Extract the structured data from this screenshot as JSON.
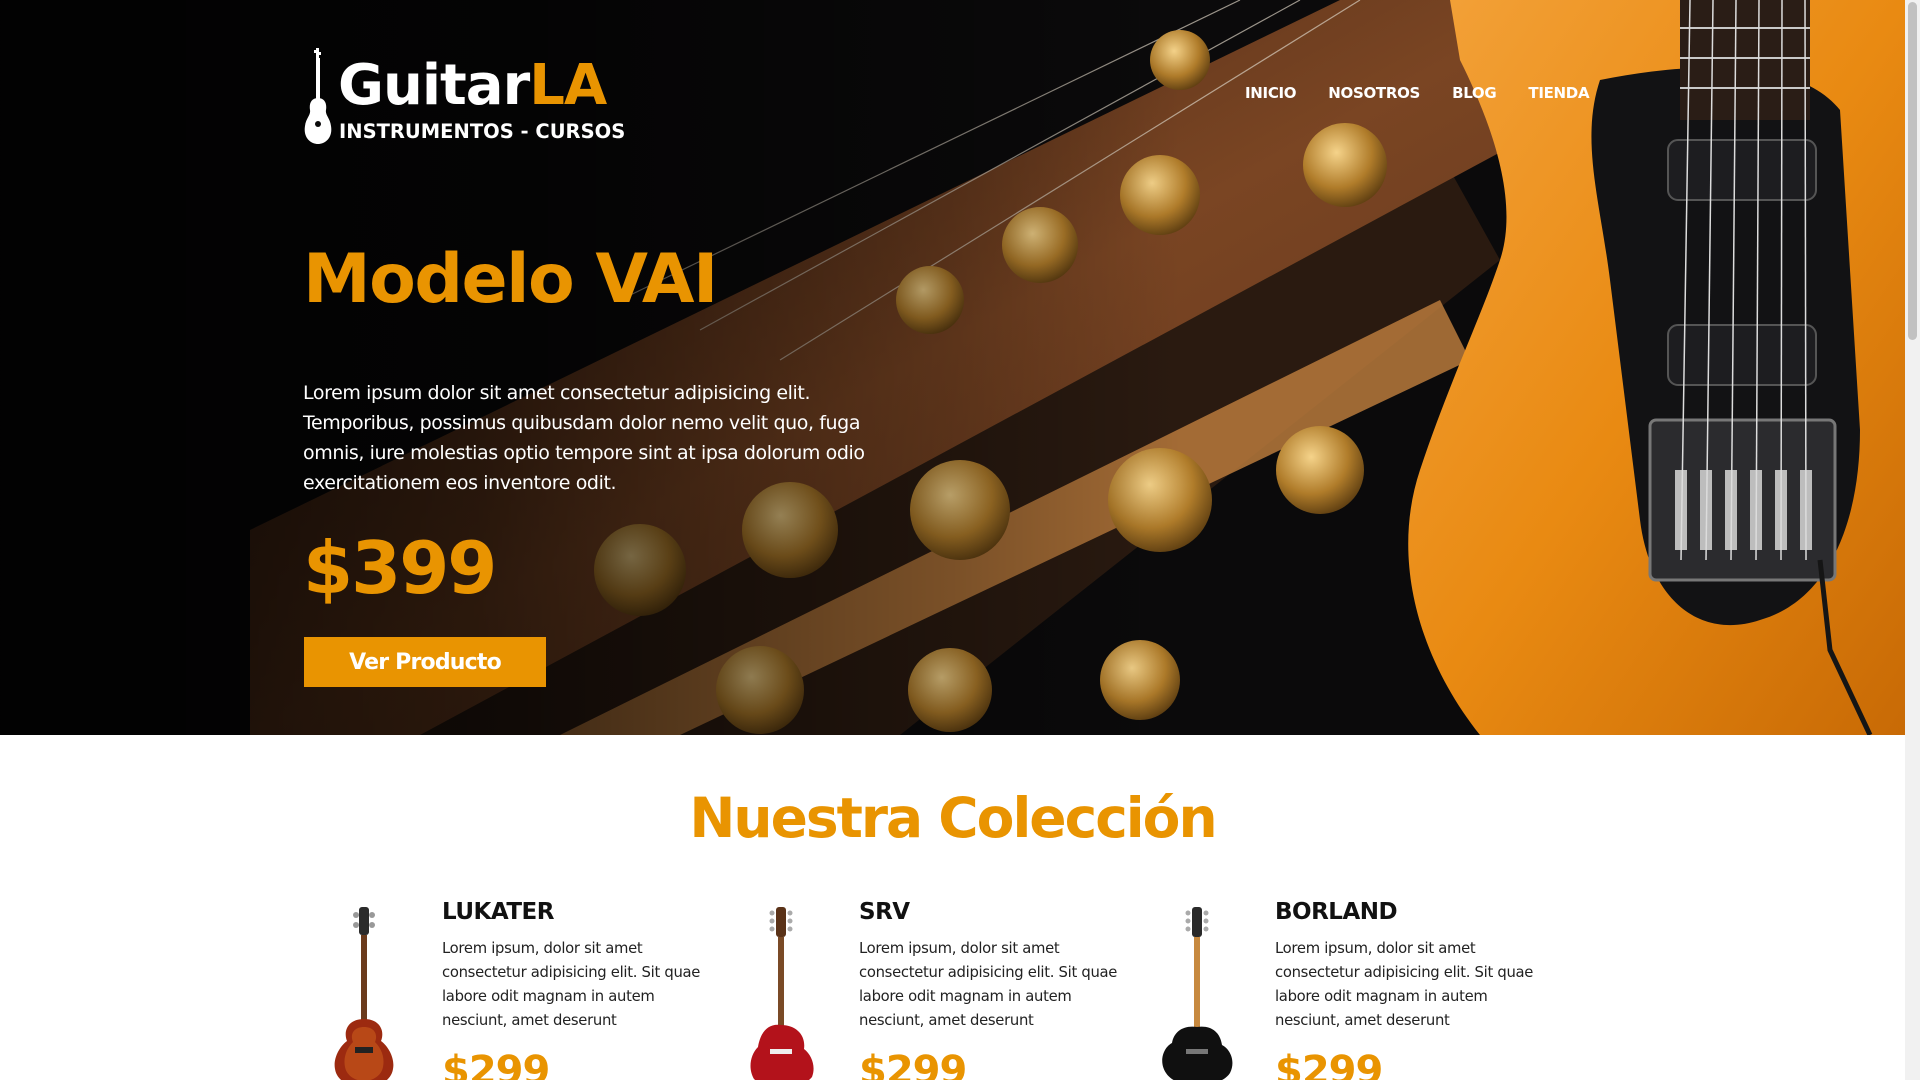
{
  "header": {
    "logo": {
      "word_main": "Guitar",
      "word_accent": "LA",
      "tagline": "INSTRUMENTOS - CURSOS"
    },
    "nav": [
      {
        "label": "INICIO"
      },
      {
        "label": "NOSOTROS"
      },
      {
        "label": "BLOG"
      },
      {
        "label": "TIENDA"
      }
    ]
  },
  "hero": {
    "title": "Modelo VAI",
    "description": "Lorem ipsum dolor sit amet consectetur adipisicing elit. Temporibus, possimus quibusdam dolor nemo velit quo, fuga omnis, iure molestias optio tempore sint at ipsa dolorum odio exercitationem eos inventore odit.",
    "price": "$399",
    "button_label": "Ver Producto"
  },
  "collection": {
    "title": "Nuestra Colección",
    "products": [
      {
        "name": "LUKATER",
        "description": "Lorem ipsum, dolor sit amet consectetur adipisicing elit. Sit quae labore odit magnam in autem nesciunt, amet deserunt",
        "price": "$299"
      },
      {
        "name": "SRV",
        "description": "Lorem ipsum, dolor sit amet consectetur adipisicing elit. Sit quae labore odit magnam in autem nesciunt, amet deserunt",
        "price": "$299"
      },
      {
        "name": "BORLAND",
        "description": "Lorem ipsum, dolor sit amet consectetur adipisicing elit. Sit quae labore odit magnam in autem nesciunt, amet deserunt",
        "price": "$299"
      }
    ]
  },
  "colors": {
    "accent": "#e99401",
    "hero_bg": "#0b0a0b",
    "text_dark": "#111111",
    "white": "#ffffff"
  },
  "icons": {
    "logo": "guitar-silhouette-icon"
  }
}
